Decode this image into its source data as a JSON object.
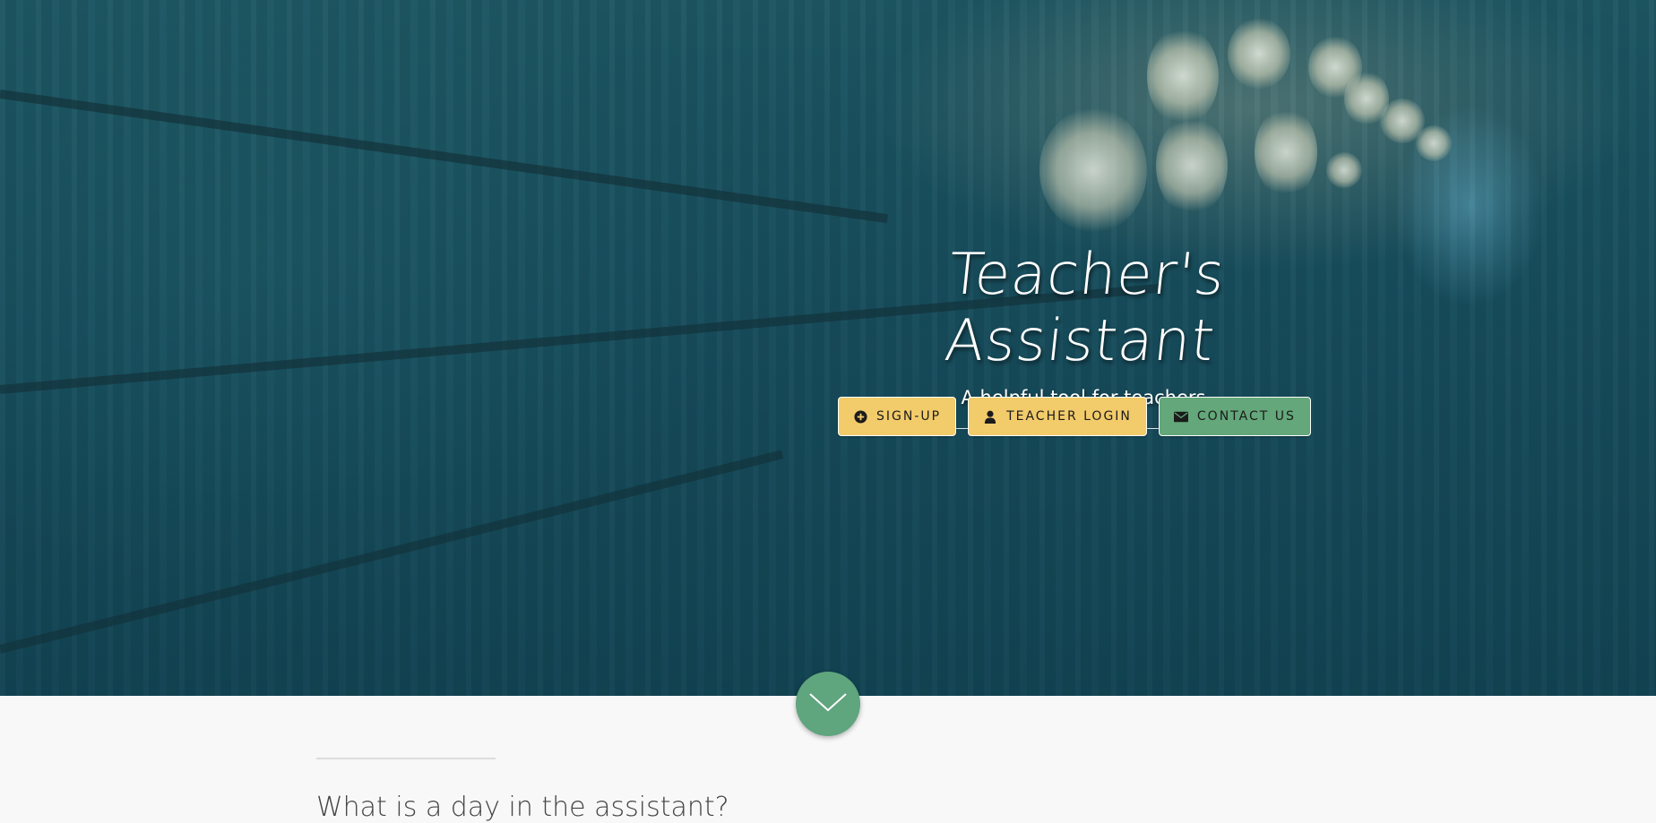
{
  "hero": {
    "title": "Teacher's Assistant",
    "subtitle": "A helpful tool for teachers"
  },
  "buttons": {
    "signup": {
      "label": "SIGN-UP",
      "icon": "plus-circle-icon"
    },
    "teacher_login": {
      "label": "TEACHER LOGIN",
      "icon": "user-icon"
    },
    "contact": {
      "label": "CONTACT US",
      "icon": "envelope-icon"
    }
  },
  "scroll": {
    "icon": "chevron-down-icon"
  },
  "section": {
    "heading": "What is a day in the assistant?"
  },
  "colors": {
    "button_yellow": "#f2cb6b",
    "button_green": "#63a77a",
    "scroll_green": "#5fa57e",
    "hero_teal": "#1a5160",
    "page_bg": "#f8f8f8"
  }
}
